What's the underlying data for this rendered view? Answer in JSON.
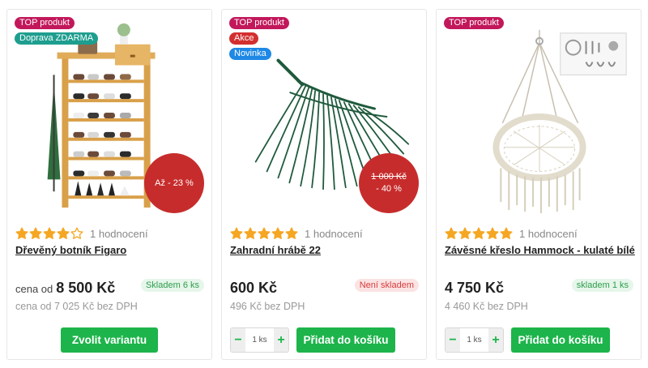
{
  "products": [
    {
      "flags": [
        "TOP produkt",
        "Doprava ZDARMA"
      ],
      "discount_label": "Až - 23 %",
      "rating_stars": 4,
      "rating_text": "1 hodnocení",
      "title": "Dřevěný botník Figaro",
      "price_prefix": "cena od",
      "price": "8 500 Kč",
      "price_sub": "cena od 7 025 Kč bez DPH",
      "stock": "Skladem 6 ks",
      "button": "Zvolit variantu"
    },
    {
      "flags": [
        "TOP produkt",
        "Akce",
        "Novinka"
      ],
      "discount_old": "1 000 Kč",
      "discount_label": "- 40 %",
      "rating_stars": 5,
      "rating_text": "1 hodnocení",
      "title": "Zahradní hrábě 22",
      "price": "600 Kč",
      "price_sub": "496 Kč bez DPH",
      "stock": "Není skladem",
      "qty_minus": "−",
      "qty_value": "1 ks",
      "qty_plus": "+",
      "button": "Přidat do košíku"
    },
    {
      "flags": [
        "TOP produkt"
      ],
      "rating_stars": 5,
      "rating_text": "1 hodnocení",
      "title": "Závěsné křeslo Hammock - kulaté bílé",
      "price": "4 750 Kč",
      "price_sub": "4 460 Kč bez DPH",
      "stock": "skladem 1 ks",
      "qty_minus": "−",
      "qty_value": "1 ks",
      "qty_plus": "+",
      "button": "Přidat do košíku"
    }
  ],
  "colors": {
    "accent_green": "#1db44b",
    "star": "#f5a623",
    "discount_red": "#c72c2c",
    "top_flag": "#c2185b",
    "free_shipping_flag": "#1e9e8f",
    "akce_flag": "#d32f2f",
    "novinka_flag": "#1e88e5"
  },
  "icons": {
    "star": "star-icon",
    "minus": "minus-icon",
    "plus": "plus-icon"
  }
}
